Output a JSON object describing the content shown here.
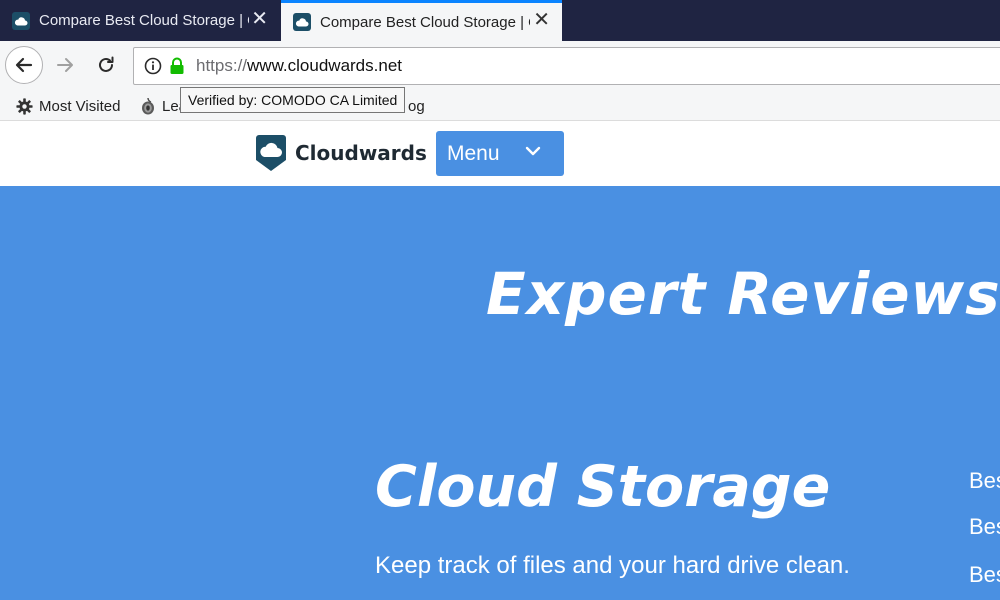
{
  "browser": {
    "tabs": [
      {
        "title": "Compare Best Cloud Storage | Onl",
        "state": "inactive"
      },
      {
        "title": "Compare Best Cloud Storage | Onl",
        "state": "active"
      }
    ],
    "url": {
      "scheme": "https://",
      "rest": "www.cloudwards.net"
    },
    "tooltip": "Verified by: COMODO CA Limited",
    "bookmarks": [
      {
        "label": "Most Visited",
        "icon": "gear-icon"
      },
      {
        "label": "Lea",
        "icon": "tor-onion-icon"
      },
      {
        "label": "og",
        "icon": ""
      }
    ]
  },
  "site": {
    "logo_text": "Cloudwards",
    "menu_label": "Menu",
    "hero_title": "Expert Reviews. Simple Advice.",
    "section_title": "Cloud Storage",
    "section_subtitle": "Keep track of files and your hard drive clean.",
    "side_links": [
      "Best",
      "Best",
      "Best"
    ]
  },
  "colors": {
    "tabstrip": "#1f2442",
    "active_tab_accent": "#0a84ff",
    "hero_blue": "#4a90e2",
    "lock_green": "#12bc00",
    "favicon_bg": "#1c4e67"
  }
}
